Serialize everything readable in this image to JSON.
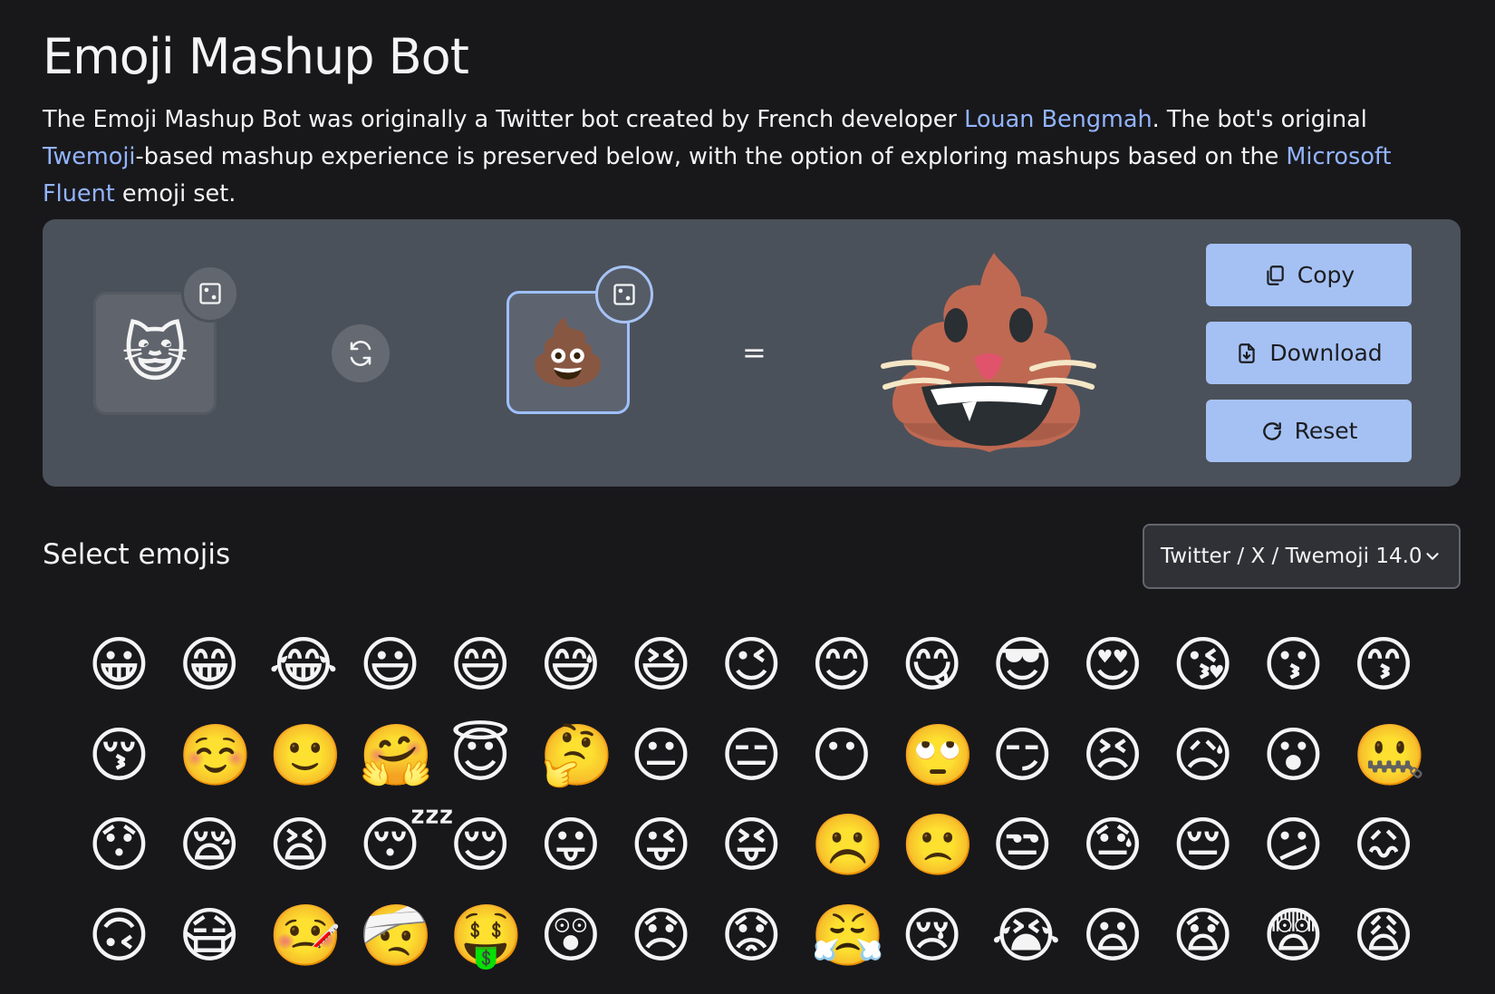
{
  "title": "Emoji Mashup Bot",
  "intro": {
    "part1": "The Emoji Mashup Bot was originally a Twitter bot created by French developer ",
    "link1": "Louan Bengmah",
    "part2": ". The bot's original ",
    "link2": "Twemoji",
    "part3": "-based mashup experience is preserved below, with the option of exploring mashups based on the ",
    "link3": "Microsoft Fluent",
    "part4": " emoji set."
  },
  "mashup": {
    "left_emoji": "😺",
    "right_emoji": "💩",
    "equals": "=",
    "buttons": {
      "copy": "Copy",
      "download": "Download",
      "reset": "Reset"
    }
  },
  "select": {
    "title": "Select emojis",
    "set_value": "Twitter / X / Twemoji 14.0"
  },
  "emojis": [
    "😀",
    "😁",
    "😂",
    "😃",
    "😄",
    "😅",
    "😆",
    "😉",
    "😊",
    "😋",
    "😎",
    "😍",
    "😘",
    "😗",
    "😙",
    "😚",
    "☺️",
    "🙂",
    "🤗",
    "😇",
    "🤔",
    "😐",
    "😑",
    "😶",
    "🙄",
    "😏",
    "😣",
    "😥",
    "😮",
    "🤐",
    "😯",
    "😪",
    "😫",
    "😴",
    "😌",
    "😛",
    "😜",
    "😝",
    "☹️",
    "🙁",
    "😒",
    "😓",
    "😔",
    "😕",
    "😖",
    "🙃",
    "😷",
    "🤒",
    "🤕",
    "🤑",
    "😲",
    "😞",
    "😟",
    "😤",
    "😢",
    "😭",
    "😦",
    "😧",
    "😨",
    "😩"
  ],
  "colors": {
    "background": "#18181b",
    "panel": "#4b515a",
    "accent_button": "#a5c1f4",
    "link": "#93b4ff"
  },
  "icons": {
    "dice": "dice-icon",
    "swap": "refresh-icon",
    "copy": "copy-icon",
    "download": "download-icon",
    "reset": "reset-icon",
    "dropdown": "chevron-down-icon"
  }
}
